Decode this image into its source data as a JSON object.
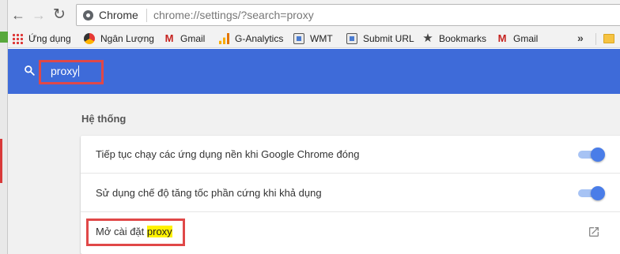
{
  "browser": {
    "tab_site_label": "Chrome",
    "url": "chrome://settings/?search=proxy",
    "bookmarks": [
      {
        "label": "Ứng dụng",
        "icon": "apps-grid-icon"
      },
      {
        "label": "Ngân Lượng",
        "icon": "nganluong-logo-icon"
      },
      {
        "label": "Gmail",
        "icon": "gmail-icon"
      },
      {
        "label": "G-Analytics",
        "icon": "google-analytics-icon"
      },
      {
        "label": "WMT",
        "icon": "page-favicon-icon"
      },
      {
        "label": "Submit URL",
        "icon": "page-favicon-icon"
      },
      {
        "label": "Bookmarks",
        "icon": "star-icon"
      },
      {
        "label": "Gmail",
        "icon": "gmail-icon"
      }
    ],
    "overflow_label": "»"
  },
  "settings": {
    "search_query": "proxy",
    "section_title": "Hệ thống",
    "rows": [
      {
        "label": "Tiếp tục chạy các ứng dụng nền khi Google Chrome đóng",
        "toggle_on": true
      },
      {
        "label": "Sử dụng chế độ tăng tốc phần cứng khi khả dụng",
        "toggle_on": true
      },
      {
        "label_prefix": "Mở cài đặt ",
        "label_highlight": "proxy",
        "icon": "external-link-icon"
      }
    ]
  },
  "colors": {
    "header_blue": "#3e6bd9",
    "toggle_blue": "#4a7de8",
    "annotation_red": "#e04848",
    "search_highlight": "#fff200"
  }
}
